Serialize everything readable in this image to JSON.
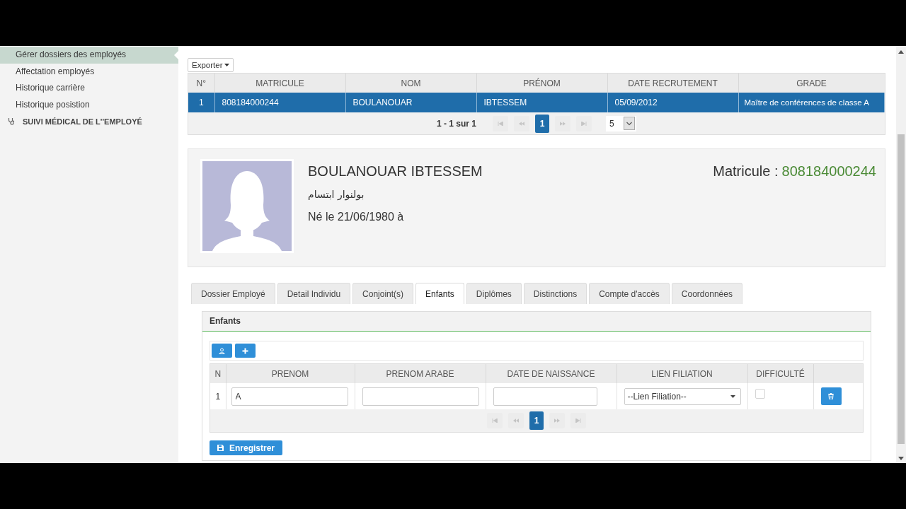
{
  "sidebar": {
    "items": [
      {
        "label": "Gérer dossiers des employés",
        "selected": true
      },
      {
        "label": "Affectation employés",
        "selected": false
      },
      {
        "label": "Historique carrière",
        "selected": false
      },
      {
        "label": "Historique posistion",
        "selected": false
      }
    ],
    "sections": [
      {
        "label": "SUIVI MÉDICAL DE L''EMPLOYÉ"
      }
    ]
  },
  "employees_table": {
    "export_button": "Exporter",
    "columns": [
      "N°",
      "MATRICULE",
      "NOM",
      "PRÉNOM",
      "DATE RECRUTEMENT",
      "GRADE"
    ],
    "rows": [
      {
        "selected": true,
        "cells": [
          "1",
          "808184000244",
          "BOULANOUAR",
          "IBTESSEM",
          "05/09/2012",
          "Maître de conférences de classe A"
        ]
      }
    ],
    "pagination": {
      "summary": "1 - 1 sur 1",
      "pages": [
        {
          "label": "1",
          "selected": true
        }
      ],
      "page_size": "5"
    }
  },
  "profile": {
    "name": "BOULANOUAR IBTESSEM",
    "name_arabic": "بولنوار ابتسام",
    "birth": "Né le 21/06/1980 à",
    "matricule_label": "Matricule :",
    "matricule": "808184000244"
  },
  "tabs": [
    {
      "label": "Dossier Employé",
      "selected": false
    },
    {
      "label": "Detail Individu",
      "selected": false
    },
    {
      "label": "Conjoint(s)",
      "selected": false
    },
    {
      "label": "Enfants",
      "selected": true
    },
    {
      "label": "Diplômes",
      "selected": false
    },
    {
      "label": "Distinctions",
      "selected": false
    },
    {
      "label": "Compte d'accès",
      "selected": false
    },
    {
      "label": "Coordonnées",
      "selected": false
    }
  ],
  "children_panel": {
    "title": "Enfants",
    "columns": [
      "N",
      "PRENOM",
      "PRENOM ARABE",
      "DATE DE NAISSANCE",
      "LIEN FILIATION",
      "DIFFICULTÉ"
    ],
    "rows": [
      {
        "number": "1",
        "prenom": "A",
        "lien_filiation": "--Lien Filiation--",
        "difficulte": false
      }
    ],
    "pagination": {
      "pages": [
        {
          "label": "1",
          "selected": true
        }
      ]
    },
    "save_button": "Enregistrer"
  }
}
